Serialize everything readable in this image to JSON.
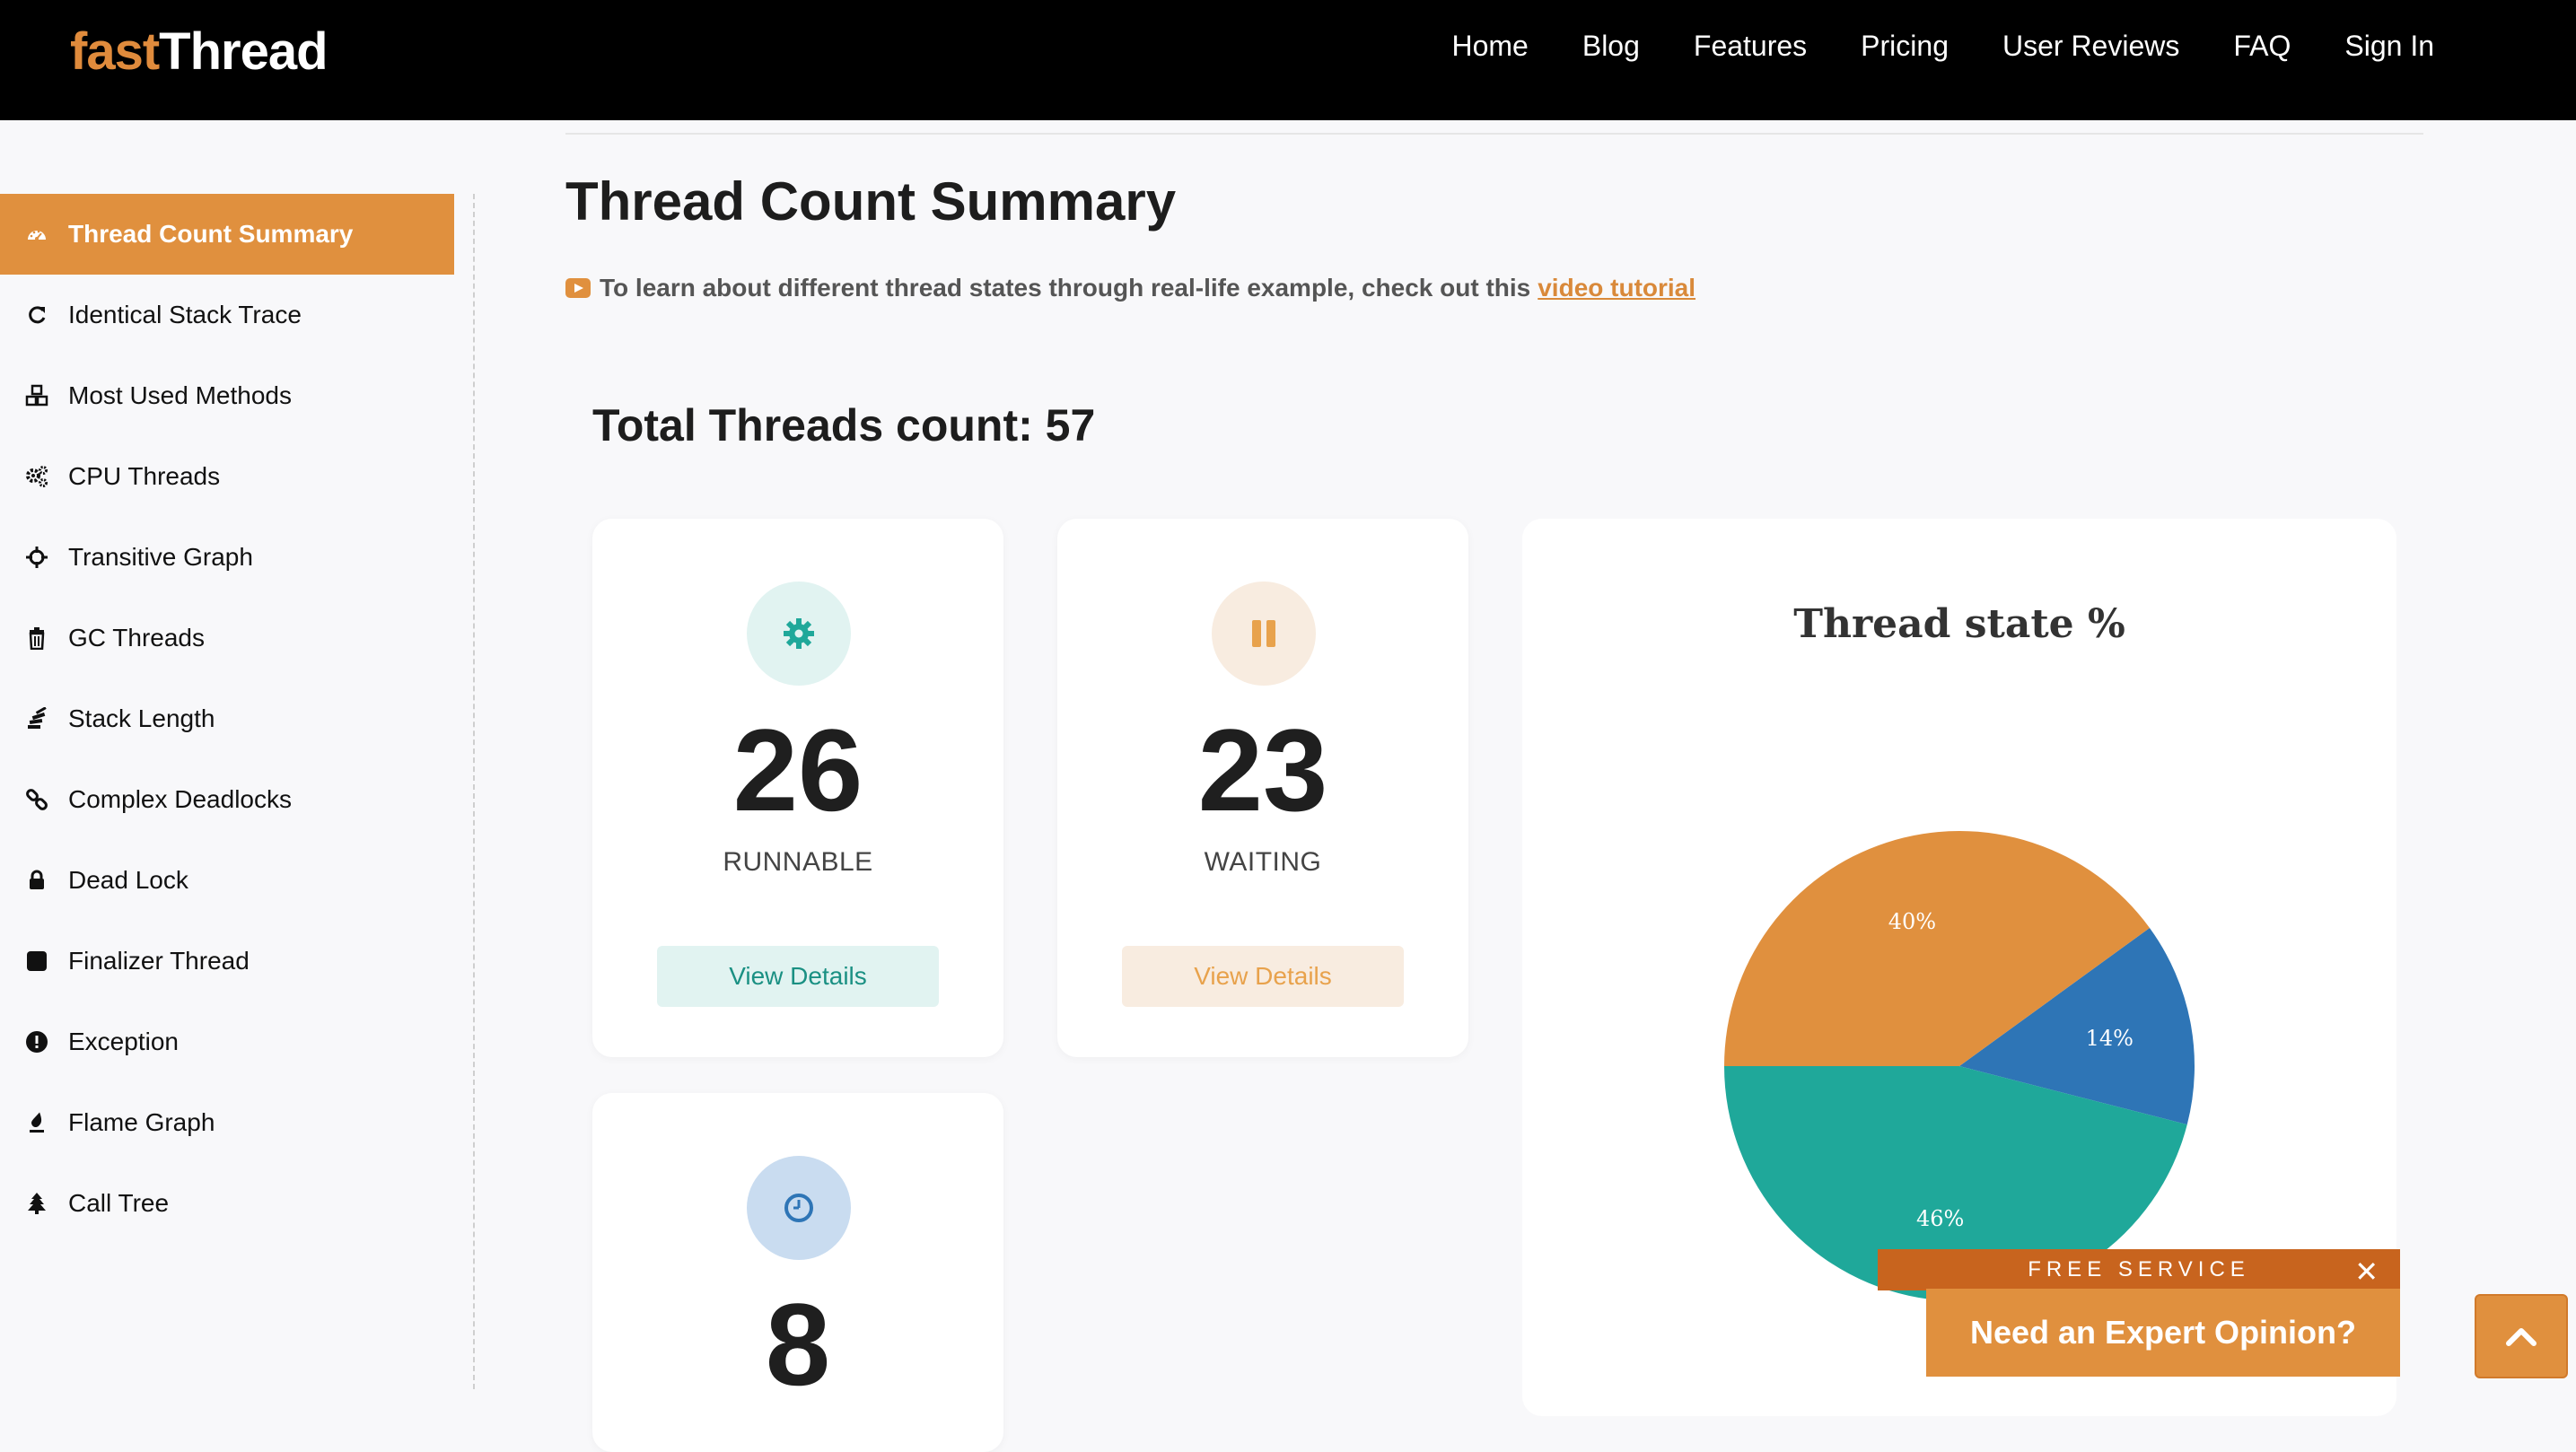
{
  "brand": {
    "part1": "fast",
    "part2": "Thread"
  },
  "nav": [
    "Home",
    "Blog",
    "Features",
    "Pricing",
    "User Reviews",
    "FAQ",
    "Sign In"
  ],
  "sidebar": {
    "items": [
      {
        "label": "Thread Count Summary",
        "icon": "dashboard-icon"
      },
      {
        "label": "Identical Stack Trace",
        "icon": "refresh-icon"
      },
      {
        "label": "Most Used Methods",
        "icon": "cubes-icon"
      },
      {
        "label": "CPU Threads",
        "icon": "gears-icon"
      },
      {
        "label": "Transitive Graph",
        "icon": "crosshair-icon"
      },
      {
        "label": "GC Threads",
        "icon": "trash-icon"
      },
      {
        "label": "Stack Length",
        "icon": "stack-icon"
      },
      {
        "label": "Complex Deadlocks",
        "icon": "link-icon"
      },
      {
        "label": "Dead Lock",
        "icon": "lock-icon"
      },
      {
        "label": "Finalizer Thread",
        "icon": "square-icon"
      },
      {
        "label": "Exception",
        "icon": "exclamation-icon"
      },
      {
        "label": "Flame Graph",
        "icon": "flame-icon"
      },
      {
        "label": "Call Tree",
        "icon": "tree-icon"
      }
    ]
  },
  "main": {
    "title": "Thread Count Summary",
    "tutorial_text": "To learn about different thread states through real-life example, check out this",
    "tutorial_link": "video tutorial",
    "total_label": "Total Threads count: 57",
    "cards": [
      {
        "count": "26",
        "state": "RUNNABLE",
        "button": "View Details",
        "icon": "gear-icon"
      },
      {
        "count": "23",
        "state": "WAITING",
        "button": "View Details",
        "icon": "pause-icon"
      },
      {
        "count": "8",
        "icon": "clock-icon"
      }
    ]
  },
  "chart_data": {
    "type": "pie",
    "title": "Thread state %",
    "slices": [
      {
        "label": "14%",
        "value": 14,
        "color": "#2e75b6"
      },
      {
        "label": "46%",
        "value": 46,
        "color": "#1fa89a"
      },
      {
        "label": "40%",
        "value": 40,
        "color": "#e0903e"
      }
    ]
  },
  "popup": {
    "free_service": "FREE SERVICE",
    "close": "✕",
    "expert": "Need an Expert Opinion?"
  },
  "colors": {
    "accent": "#e0903e",
    "runnable": "#1fa89a",
    "waiting": "#e8a24c",
    "timed": "#2e75b6"
  }
}
